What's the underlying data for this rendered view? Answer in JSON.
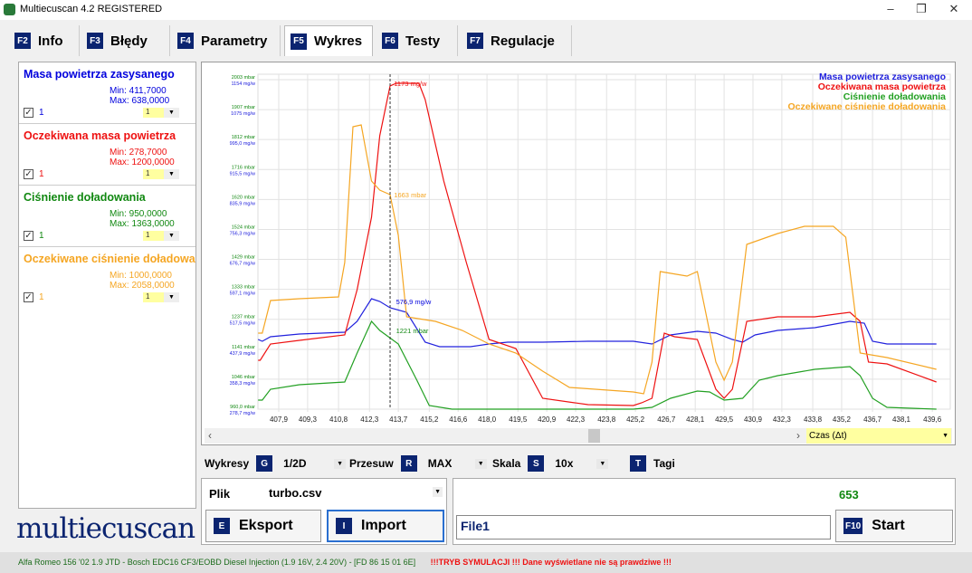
{
  "window": {
    "title": "Multiecuscan 4.2 REGISTERED"
  },
  "tabs": [
    {
      "key": "F2",
      "label": "Info"
    },
    {
      "key": "F3",
      "label": "Błędy"
    },
    {
      "key": "F4",
      "label": "Parametry"
    },
    {
      "key": "F5",
      "label": "Wykres"
    },
    {
      "key": "F6",
      "label": "Testy"
    },
    {
      "key": "F7",
      "label": "Regulacje"
    }
  ],
  "params": [
    {
      "name": "Masa powietrza zasysanego",
      "min": "Min: 411,7000",
      "max": "Max: 638,0000",
      "checked": true,
      "count": "1",
      "select": "1",
      "color": "#0000dd"
    },
    {
      "name": "Oczekiwana masa powietrza",
      "min": "Min: 278,7000",
      "max": "Max: 1200,0000",
      "checked": true,
      "count": "1",
      "select": "1",
      "color": "#ee1111"
    },
    {
      "name": "Ciśnienie doładowania",
      "min": "Min: 950,0000",
      "max": "Max: 1363,0000",
      "checked": true,
      "count": "1",
      "select": "1",
      "color": "#118811"
    },
    {
      "name": "Oczekiwane ciśnienie doładowania",
      "min": "Min: 1000,0000",
      "max": "Max: 2058,0000",
      "checked": true,
      "count": "1",
      "select": "1",
      "color": "#f5a623"
    }
  ],
  "logo": "multiecuscan",
  "chart_data": {
    "type": "line",
    "xlim": [
      406.89,
      440.47
    ],
    "x_ticks": [
      "407,9",
      "409,3",
      "410,8",
      "412,3",
      "413,7",
      "415,2",
      "416,6",
      "418,0",
      "419,5",
      "420,9",
      "422,3",
      "423,8",
      "425,2",
      "426,7",
      "428,1",
      "429,5",
      "430,9",
      "432,3",
      "433,8",
      "435,2",
      "436,7",
      "438,1",
      "439,6"
    ],
    "x_tick_values": [
      407.9,
      409.3,
      410.8,
      412.3,
      413.7,
      415.2,
      416.6,
      418.0,
      419.5,
      420.9,
      422.3,
      423.8,
      425.2,
      426.7,
      428.1,
      429.5,
      430.9,
      432.3,
      433.8,
      435.2,
      436.7,
      438.1,
      439.6
    ],
    "y_mbar_lim": [
      960,
      2003
    ],
    "y_mgw_lim": [
      278.7,
      1154
    ],
    "y_ticks_mbar": [
      "2003 mbar",
      "1907 mbar",
      "1812 mbar",
      "1716 mbar",
      "1620 mbar",
      "1524 mbar",
      "1429 mbar",
      "1333 mbar",
      "1237 mbar",
      "1141 mbar",
      "1046 mbar",
      "960,0 mbar"
    ],
    "y_ticks_mgw": [
      "1154 mg/w",
      "1075 mg/w",
      "995,0 mg/w",
      "915,5 mg/w",
      "835,9 mg/w",
      "756,3 mg/w",
      "676,7 mg/w",
      "597,1 mg/w",
      "517,5 mg/w",
      "437,9 mg/w",
      "358,3 mg/w",
      "278,7 mg/w"
    ],
    "cursor_x": 413.3,
    "annotations": [
      {
        "text": "1173 mg/w",
        "x": 413.4,
        "y": 1144,
        "axis": "mgw",
        "color": "#ee1111"
      },
      {
        "text": "1663 mbar",
        "x": 413.4,
        "y": 1639,
        "axis": "mbar",
        "color": "#f5a623"
      },
      {
        "text": "576,9 mg/w",
        "x": 413.5,
        "y": 565,
        "axis": "mgw",
        "color": "#0000dd"
      },
      {
        "text": "1221 mbar",
        "x": 413.5,
        "y": 1209,
        "axis": "mbar",
        "color": "#118811"
      }
    ],
    "legend_position": "top-right",
    "series": [
      {
        "name": "Masa powietrza zasysanego",
        "axis": "mgw",
        "color": "#2222dd",
        "x": [
          406.9,
          407.1,
          407.5,
          408.9,
          411.1,
          411.7,
          412.4,
          412.8,
          413.3,
          414.1,
          415.0,
          415.7,
          417.2,
          418.1,
          419.0,
          420.7,
          422.9,
          425.1,
          426.0,
          426.9,
          428.2,
          429.1,
          429.9,
          430.4,
          431.0,
          432.1,
          433.9,
          435.6,
          436.3,
          436.7,
          437.4,
          439.8
        ],
        "y": [
          463.9,
          459.1,
          471.1,
          478.3,
          483.1,
          512.0,
          572.1,
          564.9,
          548.1,
          536.0,
          456.7,
          444.6,
          444.6,
          451.9,
          456.7,
          456.7,
          459.1,
          459.1,
          451.9,
          475.9,
          485.5,
          480.7,
          463.9,
          456.7,
          475.9,
          487.9,
          495.1,
          512.0,
          507.2,
          459.1,
          451.9,
          451.9
        ]
      },
      {
        "name": "Oczekiwana masa powietrza",
        "axis": "mgw",
        "color": "#ee1111",
        "x": [
          406.9,
          407.0,
          407.5,
          408.9,
          411.1,
          411.7,
          412.4,
          412.8,
          413.3,
          413.6,
          414.7,
          415.0,
          415.9,
          417.0,
          418.1,
          419.4,
          420.7,
          422.9,
          425.1,
          425.5,
          426.0,
          426.6,
          427.1,
          428.2,
          429.1,
          429.5,
          429.9,
          430.6,
          432.1,
          433.9,
          435.6,
          436.1,
          436.5,
          437.4,
          439.8
        ],
        "y": [
          408.6,
          408.6,
          451.9,
          461.5,
          475.9,
          596.2,
          788.6,
          1005.0,
          1137.3,
          1144.5,
          1144.5,
          1101.2,
          884.8,
          668.3,
          463.9,
          439.8,
          307.6,
          290.7,
          288.3,
          295.5,
          307.6,
          480.7,
          471.1,
          463.9,
          331.6,
          307.6,
          331.6,
          512.0,
          524.0,
          524.0,
          536.0,
          512.0,
          403.8,
          399.0,
          350.9
        ]
      },
      {
        "name": "Ciśnienie doładowania",
        "axis": "mbar",
        "color": "#22a022",
        "x": [
          406.9,
          407.1,
          407.5,
          408.9,
          411.1,
          411.7,
          412.4,
          412.8,
          413.7,
          414.6,
          415.2,
          416.3,
          420.7,
          425.1,
          426.0,
          426.9,
          428.2,
          428.8,
          429.5,
          430.4,
          431.2,
          432.1,
          433.9,
          435.6,
          436.1,
          436.7,
          437.4,
          439.8
        ],
        "y": [
          988.7,
          988.7,
          1023.0,
          1037.4,
          1046.0,
          1137.6,
          1237.9,
          1209.3,
          1166.3,
          1051.7,
          971.5,
          960,
          960,
          960,
          965.7,
          994.4,
          1017.3,
          1014.4,
          988.7,
          994.4,
          1051.7,
          1066.0,
          1086.1,
          1094.7,
          1066.0,
          994.4,
          965.7,
          960
        ]
      },
      {
        "name": "Oczekiwane ciśnienie doładowania",
        "axis": "mbar",
        "color": "#f5a623",
        "x": [
          406.9,
          407.1,
          407.5,
          408.9,
          410.8,
          411.1,
          411.5,
          411.9,
          412.4,
          412.8,
          413.3,
          413.7,
          414.1,
          415.5,
          416.8,
          418.1,
          419.4,
          420.7,
          422.0,
          425.1,
          425.6,
          426.0,
          426.4,
          427.7,
          428.2,
          429.1,
          429.5,
          429.9,
          430.6,
          432.1,
          433.4,
          434.8,
          435.4,
          436.1,
          437.4,
          439.8
        ],
        "y": [
          1200.7,
          1200.7,
          1303.8,
          1309.5,
          1315.3,
          1424.1,
          1853.9,
          1859.6,
          1682.0,
          1653.3,
          1639.0,
          1510.1,
          1252.2,
          1237.9,
          1209.3,
          1166.3,
          1137.6,
          1080.3,
          1028.8,
          1014.4,
          1008.7,
          1109.0,
          1395.5,
          1381.2,
          1395.5,
          1109.0,
          1051.7,
          1109.0,
          1481.5,
          1515.8,
          1538.7,
          1538.7,
          1504.4,
          1137.6,
          1123.3,
          1086.1
        ]
      }
    ]
  },
  "scroll": {
    "axis_select": "Czas (Δt)"
  },
  "controls": {
    "wykresy_label": "Wykresy",
    "wykresy_key": "G",
    "wykresy_value": "1/2D",
    "przesuw_label": "Przesuw",
    "przesuw_key": "R",
    "przesuw_value": "MAX",
    "skala_label": "Skala",
    "skala_key": "S",
    "skala_value": "10x",
    "tagi_key": "T",
    "tagi_label": "Tagi"
  },
  "file": {
    "label": "Plik",
    "value": "turbo.csv",
    "export_key": "E",
    "export_label": "Eksport",
    "import_key": "I",
    "import_label": "Import"
  },
  "run": {
    "counter": "653",
    "name_value": "File1",
    "start_key": "F10",
    "start_label": "Start"
  },
  "status": {
    "vehicle": "Alfa Romeo 156 '02 1.9 JTD - Bosch EDC16 CF3/EOBD Diesel Injection (1.9 16V, 2.4 20V) - [FD 86 15 01 6E]",
    "warning": "!!!TRYB SYMULACJI !!! Dane wyświetlane nie są prawdziwe !!!"
  }
}
